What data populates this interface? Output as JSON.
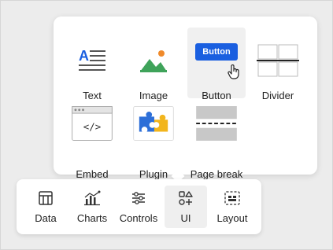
{
  "popover": {
    "items": [
      {
        "label": "Text",
        "icon": "text-icon"
      },
      {
        "label": "Image",
        "icon": "image-icon"
      },
      {
        "label": "Button",
        "icon": "button-icon",
        "inner": "Button",
        "active": true
      },
      {
        "label": "Divider",
        "icon": "divider-icon"
      },
      {
        "label": "Embed",
        "icon": "embed-icon"
      },
      {
        "label": "Plugin",
        "icon": "plugin-icon"
      },
      {
        "label": "Page break",
        "icon": "page-break-icon"
      }
    ]
  },
  "toolbar": {
    "items": [
      {
        "label": "Data",
        "icon": "table-icon"
      },
      {
        "label": "Charts",
        "icon": "charts-icon"
      },
      {
        "label": "Controls",
        "icon": "sliders-icon"
      },
      {
        "label": "UI",
        "icon": "shapes-icon",
        "active": true
      },
      {
        "label": "Layout",
        "icon": "layout-icon"
      }
    ]
  },
  "colors": {
    "accent_blue": "#1a5fe0",
    "image_green": "#3fa35a",
    "image_orange": "#f08a2a",
    "plugin_blue": "#2d6fd8",
    "plugin_yellow": "#f2b51c"
  }
}
